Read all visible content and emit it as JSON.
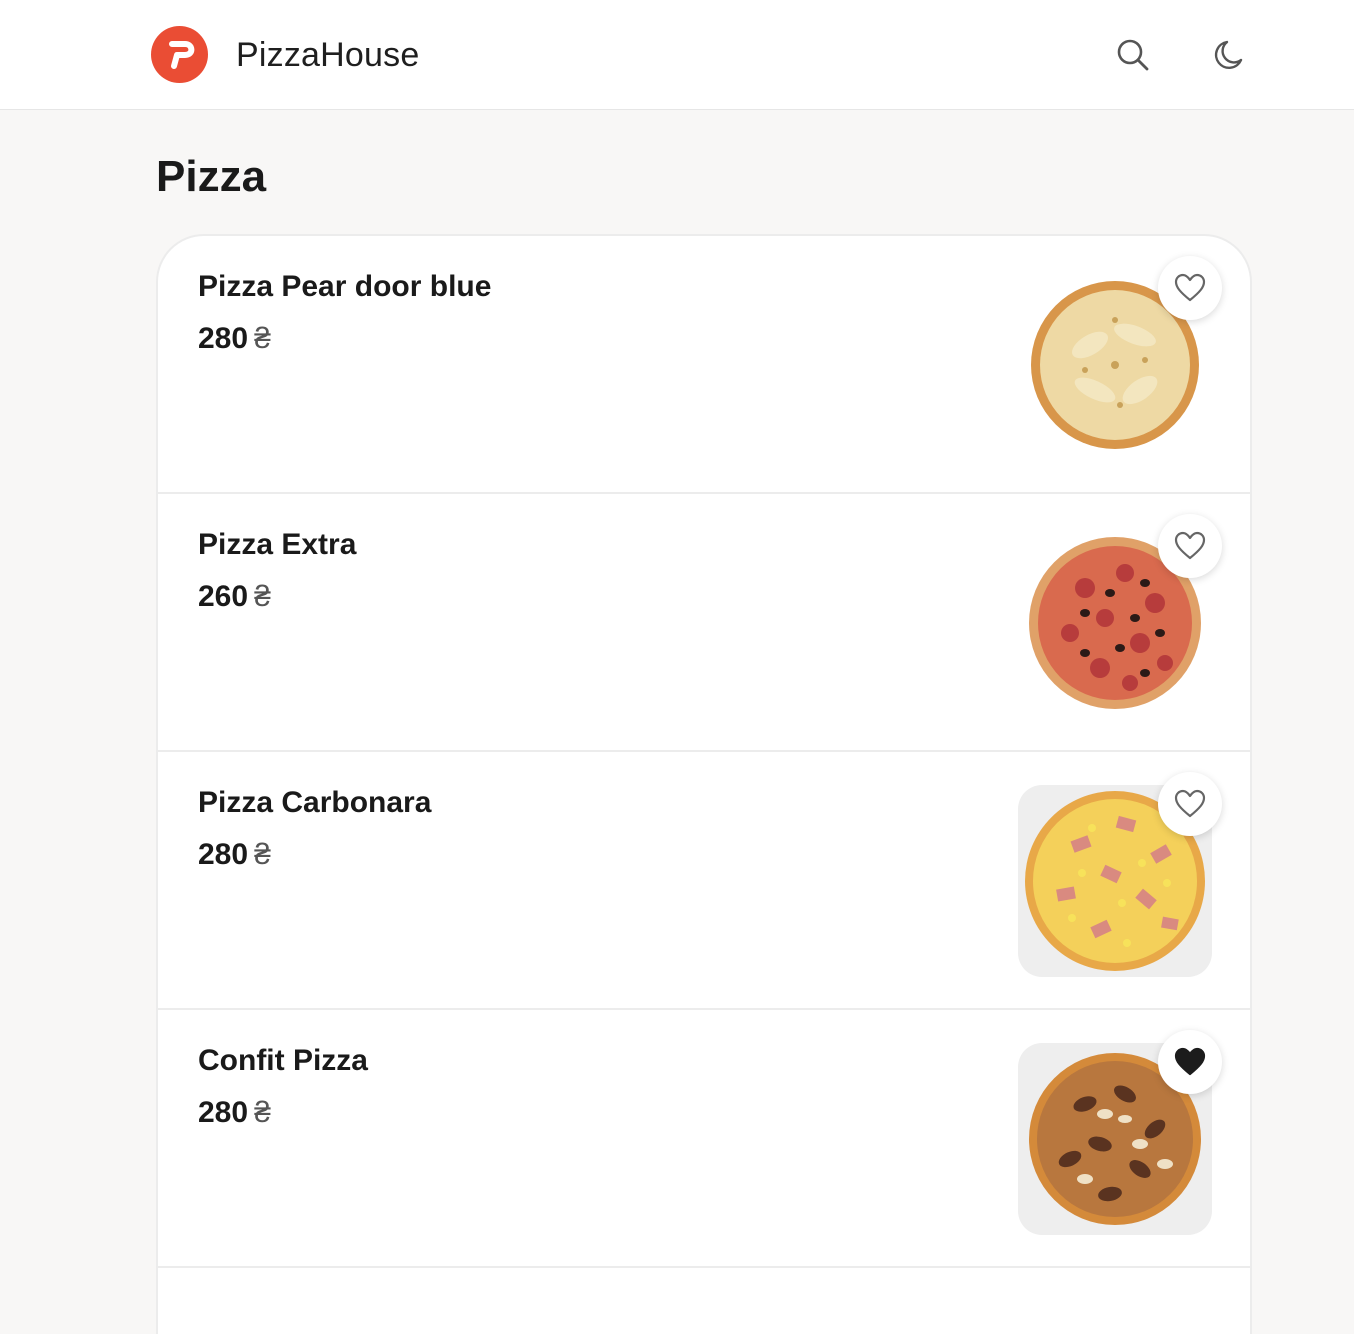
{
  "header": {
    "brand": "PizzaHouse",
    "logo_icon": "pizzahouse-logo",
    "search_icon": "search-icon",
    "theme_icon": "moon-icon",
    "accent": "#ea4d34"
  },
  "page": {
    "title": "Pizza"
  },
  "items": [
    {
      "name": "Pizza Pear door blue",
      "price": "280",
      "currency": "₴",
      "favorite": false,
      "image": "pear-pizza-image"
    },
    {
      "name": "Pizza Extra",
      "price": "260",
      "currency": "₴",
      "favorite": false,
      "image": "pepperoni-pizza-image"
    },
    {
      "name": "Pizza Carbonara",
      "price": "280",
      "currency": "₴",
      "favorite": false,
      "image": "carbonara-pizza-image"
    },
    {
      "name": "Confit Pizza",
      "price": "280",
      "currency": "₴",
      "favorite": true,
      "image": "confit-pizza-image"
    }
  ]
}
